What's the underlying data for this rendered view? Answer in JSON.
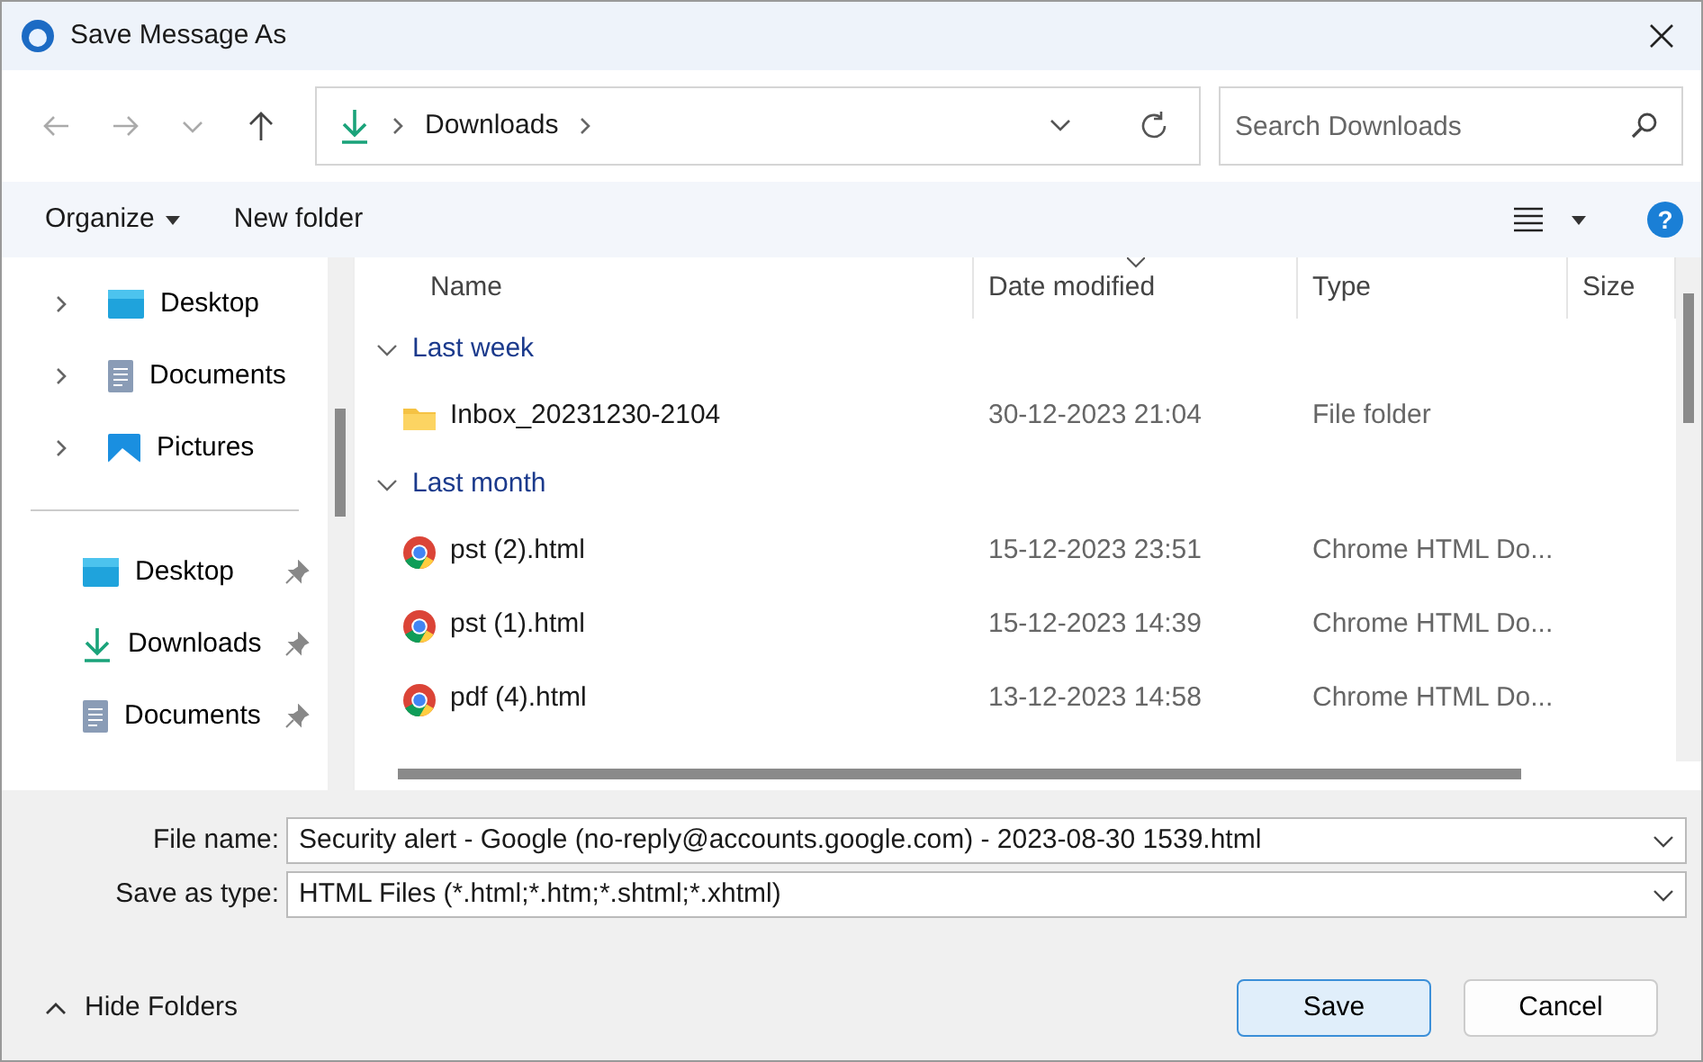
{
  "window": {
    "title": "Save Message As"
  },
  "address": {
    "segments": [
      "Downloads"
    ]
  },
  "search": {
    "placeholder": "Search Downloads"
  },
  "toolbar": {
    "organize": "Organize",
    "new_folder": "New folder",
    "help": "?"
  },
  "sidebar": {
    "tree": [
      {
        "label": "Desktop",
        "kind": "desktop"
      },
      {
        "label": "Documents",
        "kind": "documents"
      },
      {
        "label": "Pictures",
        "kind": "pictures"
      }
    ],
    "quick_access": [
      {
        "label": "Desktop",
        "kind": "desktop",
        "pinned": true
      },
      {
        "label": "Downloads",
        "kind": "downloads",
        "pinned": true
      },
      {
        "label": "Documents",
        "kind": "documents",
        "pinned": true
      }
    ]
  },
  "columns": [
    {
      "label": "Name",
      "sorted": false
    },
    {
      "label": "Date modified",
      "sorted": true
    },
    {
      "label": "Type",
      "sorted": false
    },
    {
      "label": "Size",
      "sorted": false
    }
  ],
  "groups": [
    {
      "label": "Last week",
      "expanded": true,
      "rows": [
        {
          "name": "Inbox_20231230-2104",
          "date": "30-12-2023 21:04",
          "type": "File folder",
          "kind": "folder"
        }
      ]
    },
    {
      "label": "Last month",
      "expanded": true,
      "rows": [
        {
          "name": "pst (2).html",
          "date": "15-12-2023 23:51",
          "type": "Chrome HTML Do...",
          "kind": "chrome"
        },
        {
          "name": "pst (1).html",
          "date": "15-12-2023 14:39",
          "type": "Chrome HTML Do...",
          "kind": "chrome"
        },
        {
          "name": "pdf (4).html",
          "date": "13-12-2023 14:58",
          "type": "Chrome HTML Do...",
          "kind": "chrome"
        }
      ]
    }
  ],
  "form": {
    "file_name_label": "File name:",
    "file_name": "Security alert - Google (no-reply@accounts.google.com) - 2023-08-30 1539.html",
    "type_label": "Save as type:",
    "type": "HTML Files (*.html;*.htm;*.shtml;*.xhtml)"
  },
  "hide_folders": "Hide Folders",
  "buttons": [
    {
      "label": "Save",
      "primary": true
    },
    {
      "label": "Cancel",
      "primary": false
    }
  ]
}
